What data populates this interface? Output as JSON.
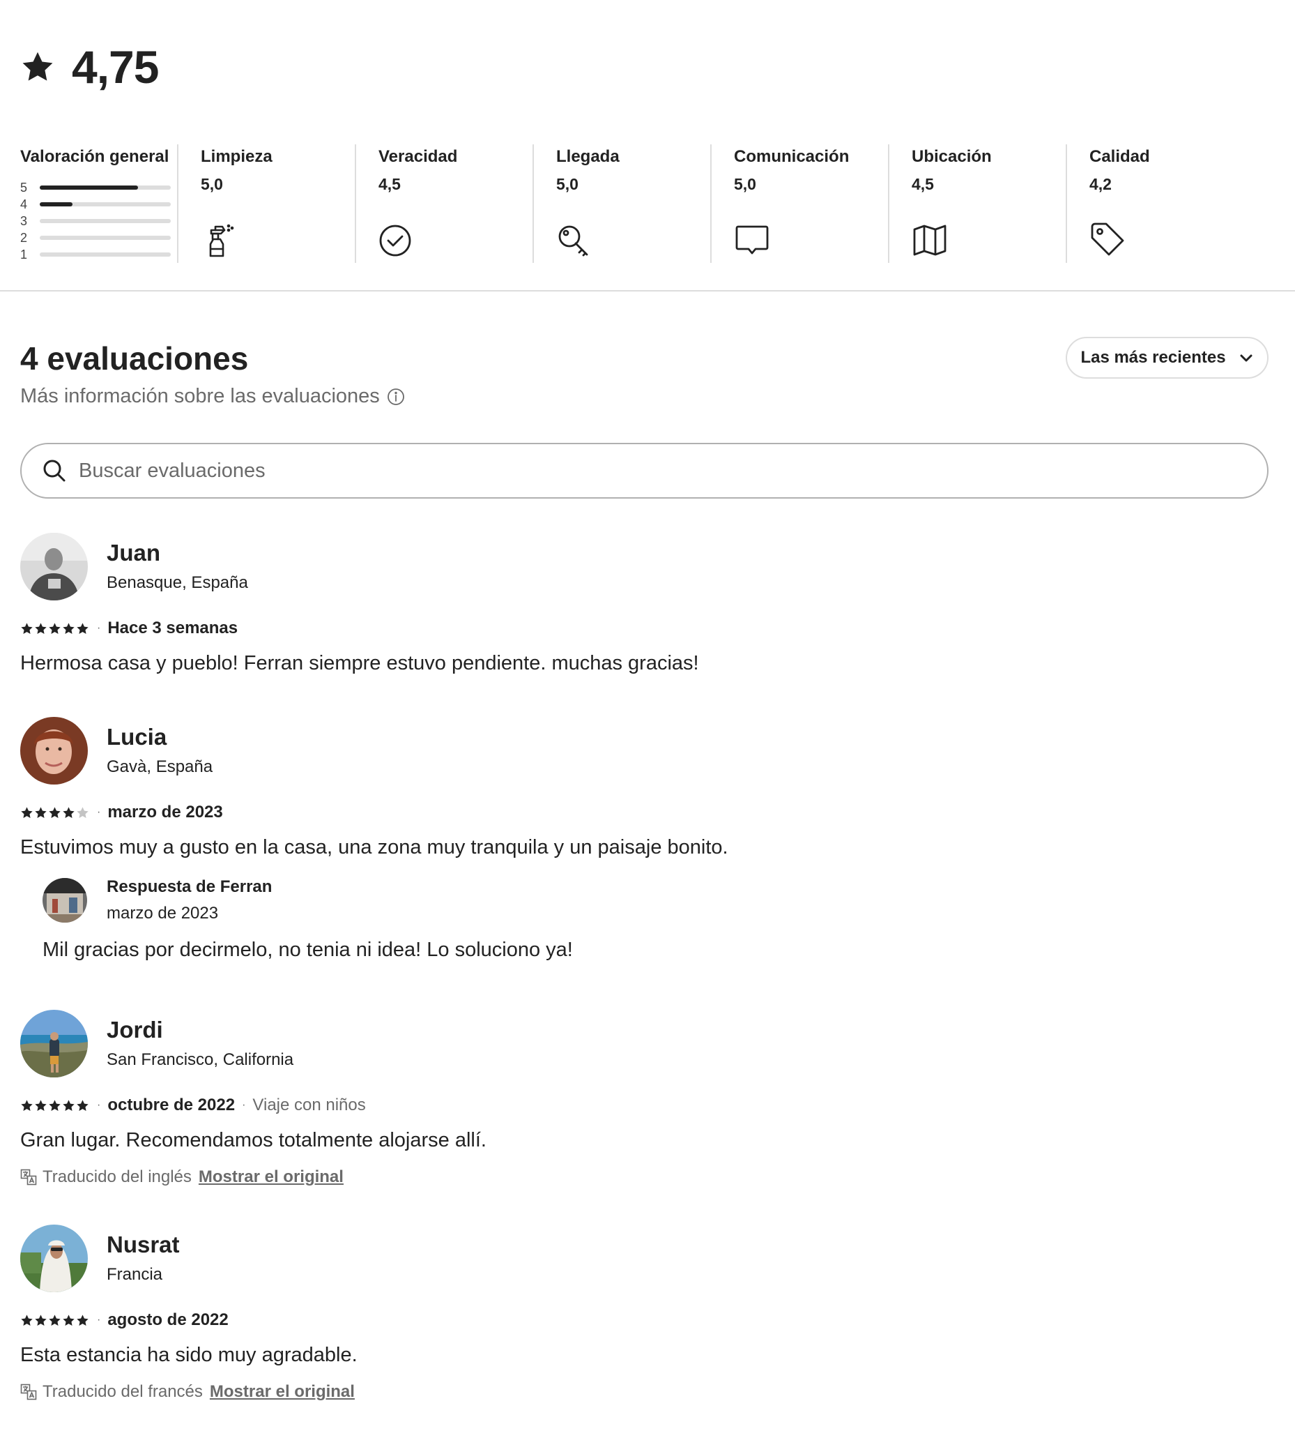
{
  "summary": {
    "overall_score": "4,75",
    "star_icon": "star-icon"
  },
  "categories": {
    "overall": {
      "title": "Valoración general",
      "distribution": [
        {
          "label": "5",
          "fraction": 0.75
        },
        {
          "label": "4",
          "fraction": 0.25
        },
        {
          "label": "3",
          "fraction": 0
        },
        {
          "label": "2",
          "fraction": 0
        },
        {
          "label": "1",
          "fraction": 0
        }
      ]
    },
    "items": [
      {
        "title": "Limpieza",
        "value": "5,0",
        "icon": "spray-bottle-icon"
      },
      {
        "title": "Veracidad",
        "value": "4,5",
        "icon": "check-circle-icon"
      },
      {
        "title": "Llegada",
        "value": "5,0",
        "icon": "key-icon"
      },
      {
        "title": "Comunicación",
        "value": "5,0",
        "icon": "message-icon"
      },
      {
        "title": "Ubicación",
        "value": "4,5",
        "icon": "map-icon"
      },
      {
        "title": "Calidad",
        "value": "4,2",
        "icon": "tag-icon"
      }
    ]
  },
  "reviews_header": {
    "title": "4 evaluaciones",
    "info_link": "Más información sobre las evaluaciones",
    "sort_label": "Las más recientes"
  },
  "search": {
    "placeholder": "Buscar evaluaciones"
  },
  "reviews": [
    {
      "name": "Juan",
      "location": "Benasque, España",
      "rating": 5,
      "date": "Hace 3 semanas",
      "trip_type": "",
      "text": "Hermosa casa y pueblo! Ferran siempre estuvo pendiente. muchas gracias!"
    },
    {
      "name": "Lucia",
      "location": "Gavà, España",
      "rating": 4,
      "date": "marzo de 2023",
      "trip_type": "",
      "text": "Estuvimos muy a gusto en la casa, una zona muy tranquila y un paisaje bonito.",
      "response": {
        "title": "Respuesta de Ferran",
        "date": "marzo de 2023",
        "text": "Mil gracias por decirmelo, no tenia ni idea! Lo soluciono ya!"
      }
    },
    {
      "name": "Jordi",
      "location": "San Francisco, California",
      "rating": 5,
      "date": "octubre de 2022",
      "trip_type": "Viaje con niños",
      "text": "Gran lugar. Recomendamos totalmente alojarse allí.",
      "translation_note": "Traducido del inglés",
      "show_original": "Mostrar el original"
    },
    {
      "name": "Nusrat",
      "location": "Francia",
      "rating": 5,
      "date": "agosto de 2022",
      "trip_type": "",
      "text": "Esta estancia ha sido muy agradable.",
      "translation_note": "Traducido del francés",
      "show_original": "Mostrar el original"
    }
  ],
  "colors": {
    "text": "#222222",
    "muted": "#6a6a6a",
    "divider": "#dddddd",
    "star_inactive": "#c4c4c4"
  }
}
